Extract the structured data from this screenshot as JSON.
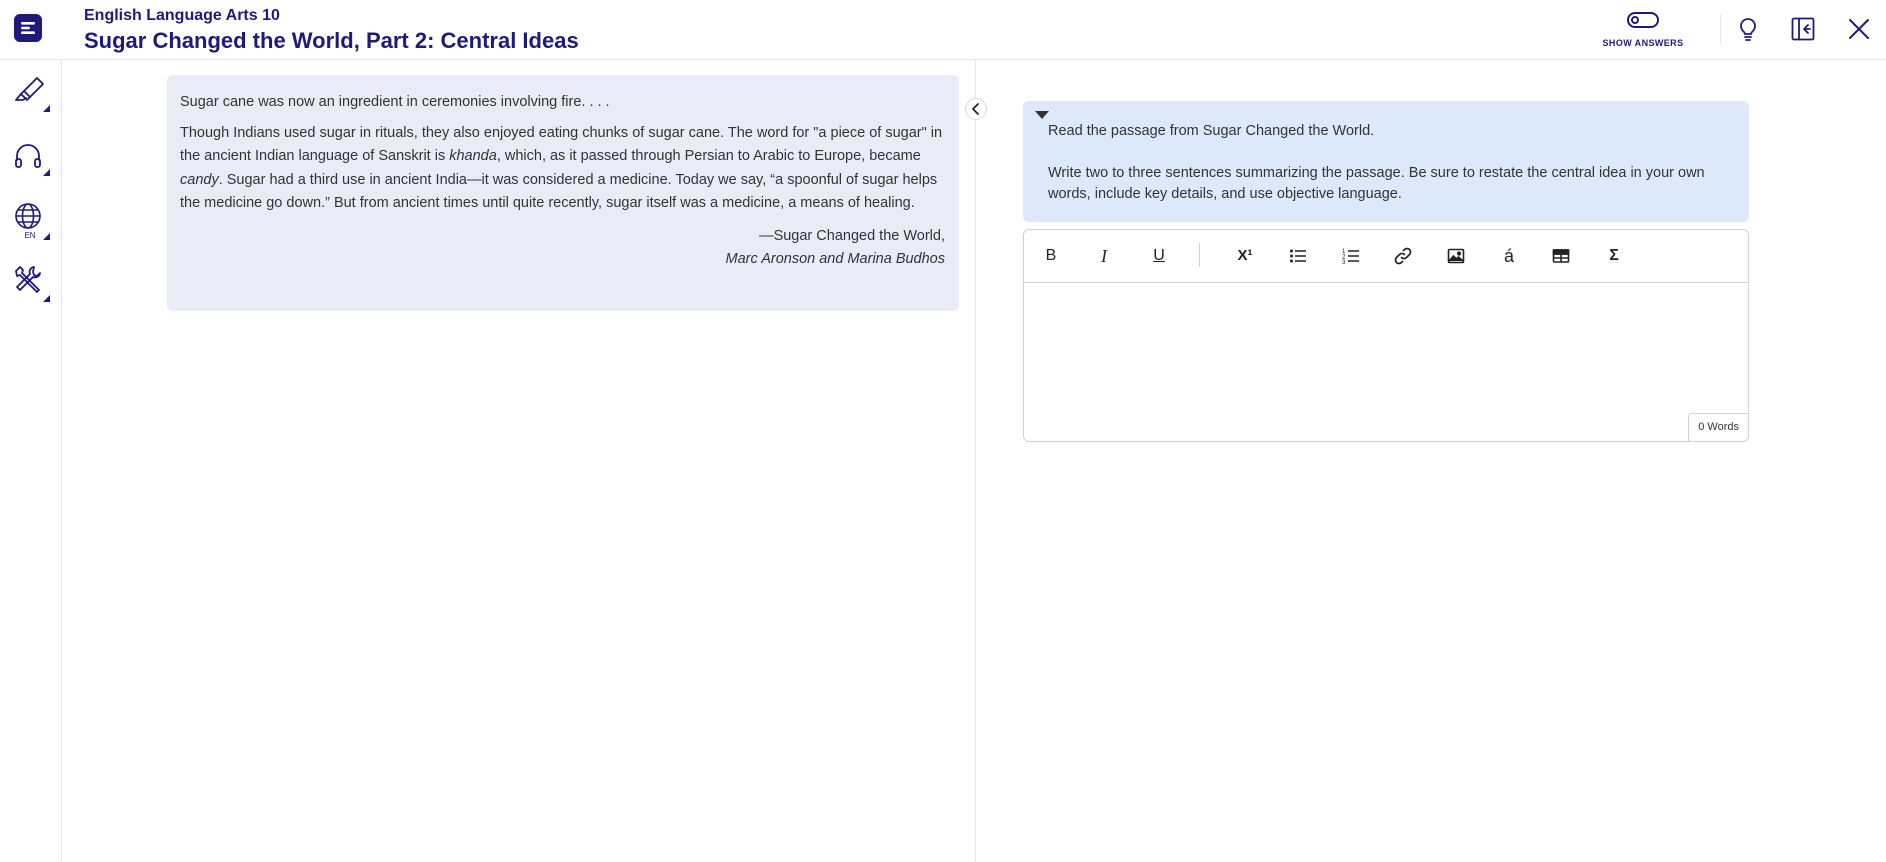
{
  "header": {
    "course": "English Language Arts 10",
    "title": "Sugar Changed the World, Part 2: Central Ideas",
    "show_answers_label": "SHOW ANSWERS"
  },
  "rail": {
    "language_code": "EN"
  },
  "passage": {
    "line1": "Sugar cane was now an ingredient in ceremonies involving fire. . . .",
    "para_a": "Though Indians used sugar in rituals, they also enjoyed eating chunks of sugar cane. The word for \"a piece of sugar\" in the ancient Indian language of Sanskrit is ",
    "word_khanda": "khanda",
    "para_b": ", which, as it passed through Persian to Arabic to Europe, became ",
    "word_candy": "candy",
    "para_c": ". Sugar had a third use in ancient India—it was considered a medicine. Today we say, “a spoonful of sugar helps the medicine go down.” But from ancient times until quite recently, sugar itself was a medicine, a means of healing.",
    "attribution": "—Sugar Changed the World,",
    "authors": "Marc Aronson and Marina Budhos"
  },
  "prompt": {
    "line1": "Read the passage from Sugar Changed the World.",
    "line2": "Write two to three sentences summarizing the passage. Be sure to restate the central idea in your own words, include key details, and use objective language."
  },
  "editor": {
    "toolbar": {
      "bold": "B",
      "italic": "I",
      "underline": "U",
      "superscript": "X¹",
      "accent": "á",
      "equation": "Σ"
    },
    "word_count": "0 Words"
  },
  "colors": {
    "brand": "#1f1a7a",
    "passage_bg": "#e9ecf6",
    "prompt_bg": "#dde9fb"
  }
}
